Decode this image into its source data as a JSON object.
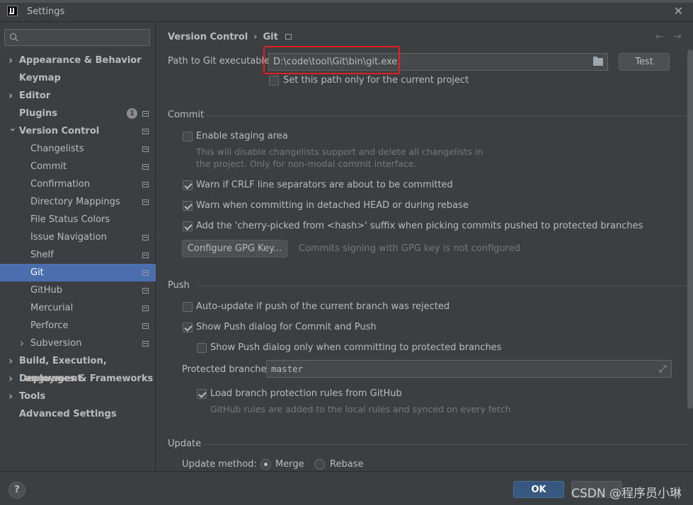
{
  "window": {
    "title": "Settings"
  },
  "sidebar": {
    "search_placeholder": "",
    "items": [
      {
        "label": "Appearance & Behavior",
        "bold": true,
        "chevron": "right"
      },
      {
        "label": "Keymap",
        "bold": true
      },
      {
        "label": "Editor",
        "bold": true,
        "chevron": "right"
      },
      {
        "label": "Plugins",
        "bold": true,
        "badge": "1"
      },
      {
        "label": "Version Control",
        "bold": true,
        "chevron": "down"
      },
      {
        "label": "Changelists"
      },
      {
        "label": "Commit"
      },
      {
        "label": "Confirmation"
      },
      {
        "label": "Directory Mappings"
      },
      {
        "label": "File Status Colors"
      },
      {
        "label": "Issue Navigation"
      },
      {
        "label": "Shelf"
      },
      {
        "label": "Git",
        "selected": true
      },
      {
        "label": "GitHub"
      },
      {
        "label": "Mercurial"
      },
      {
        "label": "Perforce"
      },
      {
        "label": "Subversion",
        "chevron": "right"
      },
      {
        "label": "Build, Execution, Deployment",
        "bold": true,
        "chevron": "right"
      },
      {
        "label": "Languages & Frameworks",
        "bold": true,
        "chevron": "right"
      },
      {
        "label": "Tools",
        "bold": true,
        "chevron": "right"
      },
      {
        "label": "Advanced Settings",
        "bold": true
      }
    ]
  },
  "main": {
    "breadcrumb": {
      "parent": "Version Control",
      "sep": "›",
      "current": "Git"
    },
    "nav": {
      "back": "←",
      "forward": "→"
    },
    "git_path": {
      "label": "Path to Git executable:",
      "value": "D:\\code\\tool\\Git\\bin\\git.exe",
      "test_button": "Test",
      "current_project_only": "Set this path only for the current project"
    },
    "commit": {
      "title": "Commit",
      "staging_area": "Enable staging area",
      "staging_note_1": "This will disable changelists support and delete all changelists in",
      "staging_note_2": "the project. Only for non-modal commit interface.",
      "crlf": "Warn if CRLF line separators are about to be committed",
      "detached_head": "Warn when committing in detached HEAD or during rebase",
      "cherry_pick": "Add the 'cherry-picked from <hash>' suffix when picking commits pushed to protected branches",
      "gpg_button": "Configure GPG Key...",
      "gpg_note": "Commits signing with GPG key is not configured"
    },
    "push": {
      "title": "Push",
      "auto_update": "Auto-update if push of the current branch was rejected",
      "show_push_dialog": "Show Push dialog for Commit and Push",
      "show_push_protected": "Show Push dialog only when committing to protected branches",
      "protected_label": "Protected branches:",
      "protected_value": "master",
      "load_rules": "Load branch protection rules from GitHub",
      "rules_note": "GitHub rules are added to the local rules and synced on every fetch"
    },
    "update": {
      "title": "Update",
      "method_label": "Update method:",
      "merge": "Merge",
      "rebase": "Rebase"
    }
  },
  "footer": {
    "help": "?",
    "ok": "OK",
    "watermark": "CSDN @程序员小琳"
  }
}
